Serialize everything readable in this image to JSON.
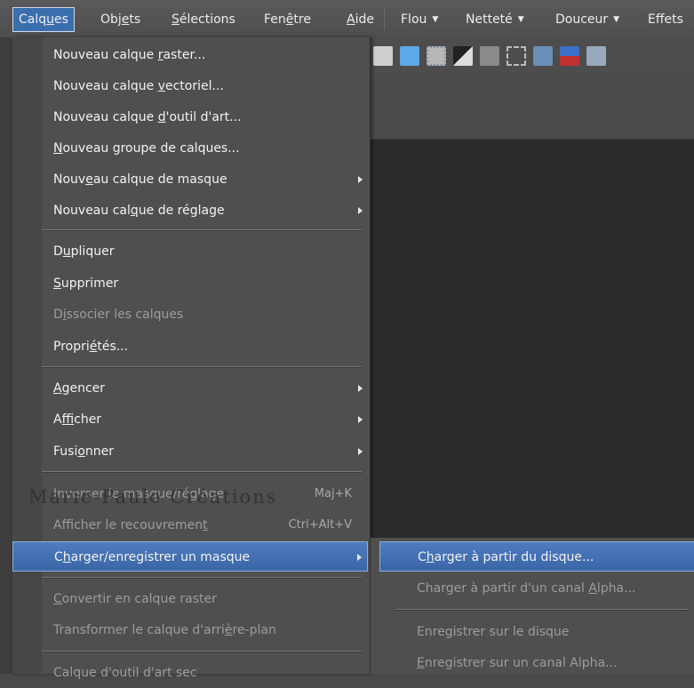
{
  "menubar": {
    "items": [
      {
        "label": "Calques",
        "mnemonic": "u"
      },
      {
        "label": "Objets",
        "mnemonic": "e"
      },
      {
        "label": "Sélections",
        "mnemonic": "S"
      },
      {
        "label": "Fenêtre",
        "mnemonic": "ê"
      },
      {
        "label": "Aide",
        "mnemonic": "A"
      }
    ],
    "effects": [
      "Flou",
      "Netteté",
      "Douceur",
      "Effets"
    ]
  },
  "layers_menu": {
    "items": [
      {
        "label": "Nouveau calque raster...",
        "has_submenu": false,
        "disabled": false
      },
      {
        "label": "Nouveau calque vectoriel...",
        "has_submenu": false,
        "disabled": false
      },
      {
        "label": "Nouveau calque d'outil d'art...",
        "has_submenu": false,
        "disabled": false
      },
      {
        "label": "Nouveau groupe de calques...",
        "has_submenu": false,
        "disabled": false
      },
      {
        "label": "Nouveau calque de masque",
        "has_submenu": true,
        "disabled": false
      },
      {
        "label": "Nouveau calque de réglage",
        "has_submenu": true,
        "disabled": false
      },
      {
        "label": "Dupliquer",
        "has_submenu": false,
        "disabled": false
      },
      {
        "label": "Supprimer",
        "has_submenu": false,
        "disabled": false
      },
      {
        "label": "Dissocier les calques",
        "has_submenu": false,
        "disabled": true
      },
      {
        "label": "Propriétés...",
        "has_submenu": false,
        "disabled": false
      },
      {
        "label": "Agencer",
        "has_submenu": true,
        "disabled": false
      },
      {
        "label": "Afficher",
        "has_submenu": true,
        "disabled": false
      },
      {
        "label": "Fusionner",
        "has_submenu": true,
        "disabled": false
      },
      {
        "label": "Inverser le masque/réglage",
        "shortcut": "Maj+K",
        "disabled": true
      },
      {
        "label": "Afficher le recouvrement",
        "shortcut": "Ctrl+Alt+V",
        "disabled": true
      },
      {
        "label": "Charger/enregistrer un masque",
        "has_submenu": true,
        "disabled": false,
        "highlighted": true
      },
      {
        "label": "Convertir en calque raster",
        "has_submenu": false,
        "disabled": true
      },
      {
        "label": "Transformer le calque d'arrière-plan",
        "has_submenu": false,
        "disabled": true
      },
      {
        "label": "Calque d'outil d'art sec",
        "has_submenu": false,
        "disabled": true
      }
    ]
  },
  "mask_submenu": {
    "items": [
      {
        "label": "Charger à partir du disque...",
        "disabled": false,
        "highlighted": true
      },
      {
        "label": "Charger à partir d'un canal Alpha...",
        "disabled": true
      },
      {
        "label": "Enregistrer sur le disque",
        "disabled": true
      },
      {
        "label": "Enregistrer sur un canal Alpha...",
        "disabled": true
      }
    ]
  },
  "watermark": "Marie-Paule Créations",
  "colors": {
    "menu_bg": "#4f4f4f",
    "highlight": "#3a66a8",
    "text": "#f2f2f2",
    "disabled": "#9c9c9c",
    "canvas": "#2c2c2c"
  }
}
